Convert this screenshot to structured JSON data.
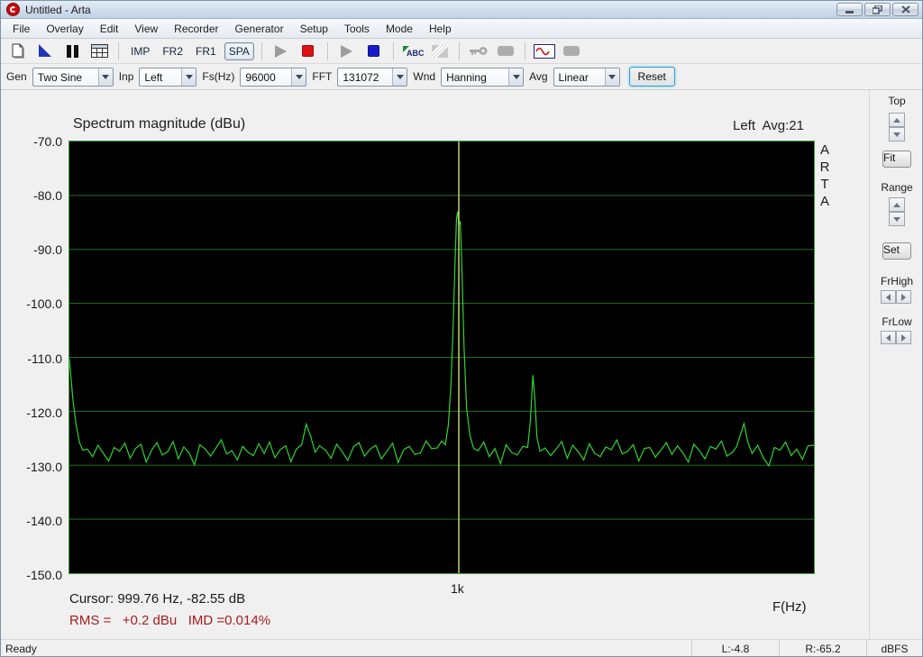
{
  "window": {
    "title": "Untitled - Arta"
  },
  "menu": {
    "items": [
      "File",
      "Overlay",
      "Edit",
      "View",
      "Recorder",
      "Generator",
      "Setup",
      "Tools",
      "Mode",
      "Help"
    ]
  },
  "toolbar": {
    "modes": [
      "IMP",
      "FR2",
      "FR1",
      "SPA"
    ],
    "active_mode": "SPA",
    "icons": [
      "new-document",
      "signal-flag",
      "pause",
      "table",
      "play-disabled",
      "record",
      "play",
      "stop",
      "spellcheck-abc",
      "no-overlay",
      "key",
      "mute",
      "sine-generator",
      "blank"
    ]
  },
  "controls": {
    "gen_label": "Gen",
    "gen_value": "Two Sine",
    "inp_label": "Inp",
    "inp_value": "Left",
    "fs_label": "Fs(Hz)",
    "fs_value": "96000",
    "fft_label": "FFT",
    "fft_value": "131072",
    "wnd_label": "Wnd",
    "wnd_value": "Hanning",
    "avg_label": "Avg",
    "avg_value": "Linear",
    "reset_label": "Reset"
  },
  "side_panel": {
    "top_label": "Top",
    "fit_label": "Fit",
    "range_label": "Range",
    "set_label": "Set",
    "frhigh_label": "FrHigh",
    "frlow_label": "FrLow"
  },
  "readouts": {
    "cursor": "Cursor: 999.76 Hz, -82.55 dB",
    "rms": "RMS =   +0.2 dBu   IMD =0.014%",
    "xaxis": "F(Hz)",
    "brand_vertical": "A\nR\nT\nA"
  },
  "statusbar": {
    "ready": "Ready",
    "left_level": "L:-4.8",
    "right_level": "R:-65.2",
    "unit": "dBFS"
  },
  "colors": {
    "trace": "#2fd42f",
    "grid": "#1e741e",
    "cursor_line": "#cde26a",
    "plot_border": "#3f9b3f",
    "plot_bg": "#000000",
    "record_red": "#dd1111",
    "stop_blue": "#1a1acc",
    "rms_text": "#a81c1c"
  },
  "chart_data": {
    "type": "line",
    "title": "Spectrum magnitude (dBu)",
    "channel_label": "Left  Avg:21",
    "channel": "Left",
    "averages": 21,
    "xlabel": "F(Hz)",
    "ylabel_unit": "dBu",
    "ylim": [
      -150,
      -70
    ],
    "ytick_step": 10,
    "yticks": [
      "-70.0",
      "-80.0",
      "-90.0",
      "-100.0",
      "-110.0",
      "-120.0",
      "-130.0",
      "-140.0",
      "-150.0"
    ],
    "xticks": [
      {
        "label": "1k",
        "frac": 0.523
      }
    ],
    "grid": "horizontal-only",
    "legend": "none",
    "cursor": {
      "freq_hz": 999.76,
      "level_db": -82.55,
      "frac": 0.523
    },
    "peaks": [
      {
        "desc": "fundamental",
        "frac": 0.522,
        "db": -83.0
      },
      {
        "desc": "imd-product",
        "frac": 0.623,
        "db": -113.3
      },
      {
        "desc": "minor",
        "frac": 0.906,
        "db": -122.3
      },
      {
        "desc": "dc-edge",
        "frac": 0.0,
        "db": -110.3
      }
    ],
    "noise_floor_db": -127.5,
    "spectrum_segments": [
      {
        "x0": 0.0,
        "dx": 0.0045,
        "values": [
          -110.3,
          -117.5,
          -122.5,
          -125.8,
          -127.2
        ]
      },
      {
        "x0": 0.024,
        "dx": 0.0072,
        "values": [
          -127.0,
          -128.4,
          -126.3,
          -127.8,
          -129.2,
          -126.7,
          -127.4,
          -125.9,
          -128.7,
          -126.9,
          -126.1,
          -129.4,
          -127.2,
          -125.8,
          -128.1,
          -127.5,
          -125.6,
          -128.8,
          -126.6,
          -127.7,
          -129.9,
          -126.2,
          -127.0,
          -128.3,
          -126.8,
          -125.3,
          -127.9,
          -127.3,
          -129.0,
          -126.5,
          -127.6,
          -128.2,
          -126.0,
          -127.8,
          -125.7,
          -128.6,
          -127.1,
          -126.4,
          -129.3,
          -127.0
        ]
      },
      {
        "x0": 0.312,
        "dx": 0.006,
        "values": [
          -126.2,
          -122.4,
          -124.6,
          -127.6,
          -126.4
        ]
      },
      {
        "x0": 0.344,
        "dx": 0.0075,
        "values": [
          -127.2,
          -128.7,
          -126.1,
          -127.5,
          -129.1,
          -126.6,
          -125.8,
          -128.3,
          -127.0,
          -126.3,
          -128.8,
          -127.4,
          -125.9,
          -129.5,
          -127.1,
          -126.5,
          -128.0,
          -127.7,
          -125.5,
          -126.9
        ]
      },
      {
        "x": [
          0.494,
          0.5,
          0.505,
          0.509,
          0.5125,
          0.5155,
          0.518,
          0.52,
          0.5215,
          0.523,
          0.525,
          0.5275,
          0.53,
          0.5335,
          0.538,
          0.543
        ],
        "values": [
          -126.8,
          -125.5,
          -126.2,
          -122.5,
          -115.0,
          -104.0,
          -92.0,
          -84.2,
          -83.0,
          -85.5,
          -84.8,
          -95.0,
          -108.0,
          -119.5,
          -124.5,
          -126.9
        ]
      },
      {
        "x0": 0.549,
        "dx": 0.0075,
        "values": [
          -127.3,
          -125.7,
          -128.4,
          -126.9,
          -129.7,
          -126.2,
          -127.6,
          -128.1,
          -126.5
        ]
      },
      {
        "x": [
          0.6155,
          0.619,
          0.6225,
          0.625,
          0.628,
          0.632
        ],
        "values": [
          -126.7,
          -122.0,
          -113.3,
          -117.5,
          -124.8,
          -127.4
        ]
      },
      {
        "x0": 0.639,
        "dx": 0.0074,
        "values": [
          -126.8,
          -128.2,
          -127.0,
          -125.6,
          -128.7,
          -126.3,
          -127.5,
          -129.0,
          -126.0,
          -127.8,
          -128.4,
          -126.6,
          -127.1,
          -125.3,
          -127.9,
          -127.4,
          -126.2,
          -129.2,
          -126.9,
          -126.7,
          -128.5,
          -127.2,
          -125.8,
          -128.0,
          -126.4,
          -127.7,
          -129.4,
          -126.1,
          -127.3,
          -128.8,
          -126.5,
          -127.0,
          -125.5,
          -128.3,
          -127.6
        ]
      },
      {
        "x": [
          0.896,
          0.902,
          0.906,
          0.911
        ],
        "values": [
          -126.6,
          -124.0,
          -122.3,
          -125.6
        ]
      },
      {
        "x0": 0.917,
        "dx": 0.0075,
        "values": [
          -127.8,
          -126.3,
          -128.6,
          -130.1,
          -126.7,
          -127.2,
          -125.7,
          -128.2,
          -127.0,
          -128.9,
          -126.4
        ]
      },
      {
        "x": [
          1.0
        ],
        "values": [
          -126.3
        ]
      }
    ]
  }
}
